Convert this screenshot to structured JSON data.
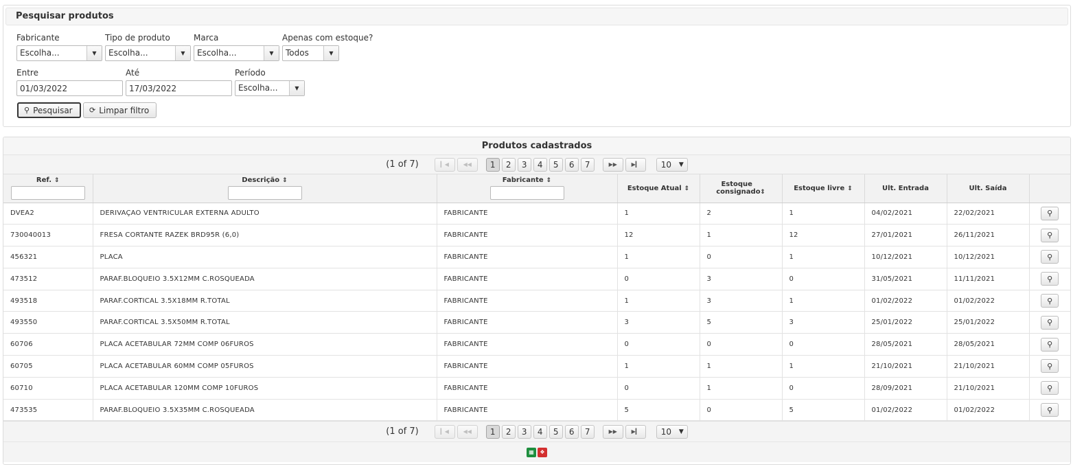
{
  "search": {
    "title": "Pesquisar produtos",
    "fabricante": {
      "label": "Fabricante",
      "value": "Escolha..."
    },
    "tipo": {
      "label": "Tipo de produto",
      "value": "Escolha..."
    },
    "marca": {
      "label": "Marca",
      "value": "Escolha..."
    },
    "estoque": {
      "label": "Apenas com estoque?",
      "value": "Todos"
    },
    "entre": {
      "label": "Entre",
      "value": "01/03/2022"
    },
    "ate": {
      "label": "Até",
      "value": "17/03/2022"
    },
    "periodo": {
      "label": "Período",
      "value": "Escolha..."
    },
    "search_button": "Pesquisar",
    "clear_button": "Limpar filtro"
  },
  "results": {
    "title": "Produtos cadastrados",
    "page_report": "(1 of 7)",
    "pages": [
      "1",
      "2",
      "3",
      "4",
      "5",
      "6",
      "7"
    ],
    "current_page": "1",
    "rows_per_page": "10",
    "columns": [
      "Ref.",
      "Descrição",
      "Fabricante",
      "Estoque Atual",
      "Estoque consignado",
      "Estoque livre",
      "Ult. Entrada",
      "Ult. Saída"
    ],
    "rows": [
      [
        "DVEA2",
        "DERIVAÇAO VENTRICULAR EXTERNA ADULTO",
        "FABRICANTE",
        "1",
        "2",
        "1",
        "04/02/2021",
        "22/02/2021"
      ],
      [
        "730040013",
        "FRESA CORTANTE RAZEK BRD95R (6,0)",
        "FABRICANTE",
        "12",
        "1",
        "12",
        "27/01/2021",
        "26/11/2021"
      ],
      [
        "456321",
        "PLACA",
        "FABRICANTE",
        "1",
        "0",
        "1",
        "10/12/2021",
        "10/12/2021"
      ],
      [
        "473512",
        "PARAF.BLOQUEIO 3.5X12MM C.ROSQUEADA",
        "FABRICANTE",
        "0",
        "3",
        "0",
        "31/05/2021",
        "11/11/2021"
      ],
      [
        "493518",
        "PARAF.CORTICAL 3.5X18MM R.TOTAL",
        "FABRICANTE",
        "1",
        "3",
        "1",
        "01/02/2022",
        "01/02/2022"
      ],
      [
        "493550",
        "PARAF.CORTICAL 3.5X50MM R.TOTAL",
        "FABRICANTE",
        "3",
        "5",
        "3",
        "25/01/2022",
        "25/01/2022"
      ],
      [
        "60706",
        "PLACA ACETABULAR 72MM COMP 06FUROS",
        "FABRICANTE",
        "0",
        "0",
        "0",
        "28/05/2021",
        "28/05/2021"
      ],
      [
        "60705",
        "PLACA ACETABULAR 60MM COMP 05FUROS",
        "FABRICANTE",
        "1",
        "1",
        "1",
        "21/10/2021",
        "21/10/2021"
      ],
      [
        "60710",
        "PLACA ACETABULAR 120MM COMP 10FUROS",
        "FABRICANTE",
        "0",
        "1",
        "0",
        "28/09/2021",
        "21/10/2021"
      ],
      [
        "473535",
        "PARAF.BLOQUEIO 3.5X35MM C.ROSQUEADA",
        "FABRICANTE",
        "5",
        "0",
        "5",
        "01/02/2022",
        "01/02/2022"
      ]
    ]
  },
  "icons": {
    "search": "magnifier-icon",
    "clear": "refresh-icon",
    "export_xls": "excel-icon",
    "export_pdf": "pdf-icon"
  },
  "colors": {
    "excel": "#1e8e3e",
    "pdf": "#d32f2f"
  }
}
